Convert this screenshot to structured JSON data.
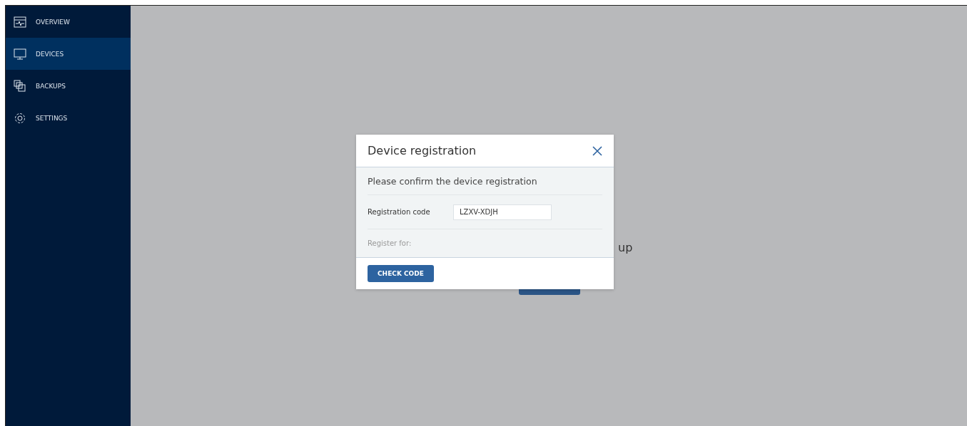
{
  "sidebar": {
    "items": [
      {
        "label": "OVERVIEW",
        "selected": false
      },
      {
        "label": "DEVICES",
        "selected": true
      },
      {
        "label": "BACKUPS",
        "selected": false
      },
      {
        "label": "SETTINGS",
        "selected": false
      }
    ]
  },
  "background": {
    "text": "up"
  },
  "dialog": {
    "title": "Device registration",
    "subtitle": "Please confirm the device registration",
    "field": {
      "label": "Registration code",
      "value": "LZXV-XDJH"
    },
    "register_label": "Register for:",
    "button": "CHECK CODE"
  }
}
